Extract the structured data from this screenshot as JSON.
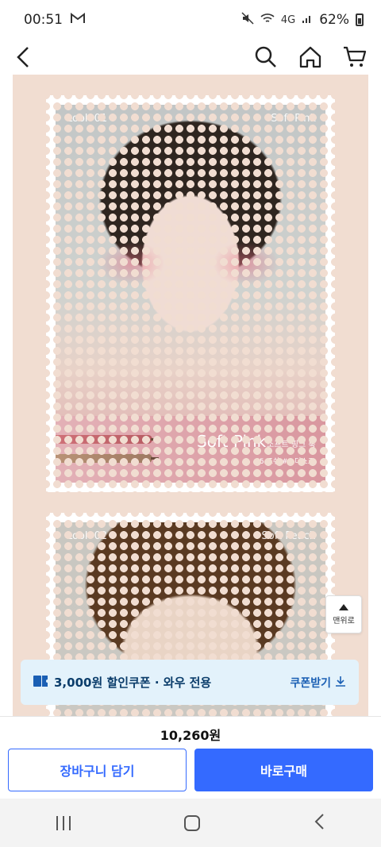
{
  "status_bar": {
    "time": "00:51",
    "network": "4G",
    "battery": "62%"
  },
  "header": {
    "icons": [
      "back-icon",
      "search-icon",
      "home-icon",
      "cart-icon"
    ]
  },
  "looks": [
    {
      "label": "Look 01",
      "name": "Soft Pink",
      "band_title": "Soft Pink",
      "band_sub": "소프트 핑크 룩",
      "shades": "#5 포쉬   #6 더스크"
    },
    {
      "label": "Look 02",
      "name": "Soft Peach"
    }
  ],
  "top_button": {
    "label": "맨위로"
  },
  "coupon": {
    "text": "3,000원 할인쿠폰 · 와우 전용",
    "action": "쿠폰받기"
  },
  "purchase": {
    "price": "10,260원",
    "cart_label": "장바구니 담기",
    "buy_label": "바로구매"
  },
  "colors": {
    "accent": "#346aff",
    "coupon_bg": "#e3f2fb",
    "page_bg": "#f1ddd1"
  }
}
